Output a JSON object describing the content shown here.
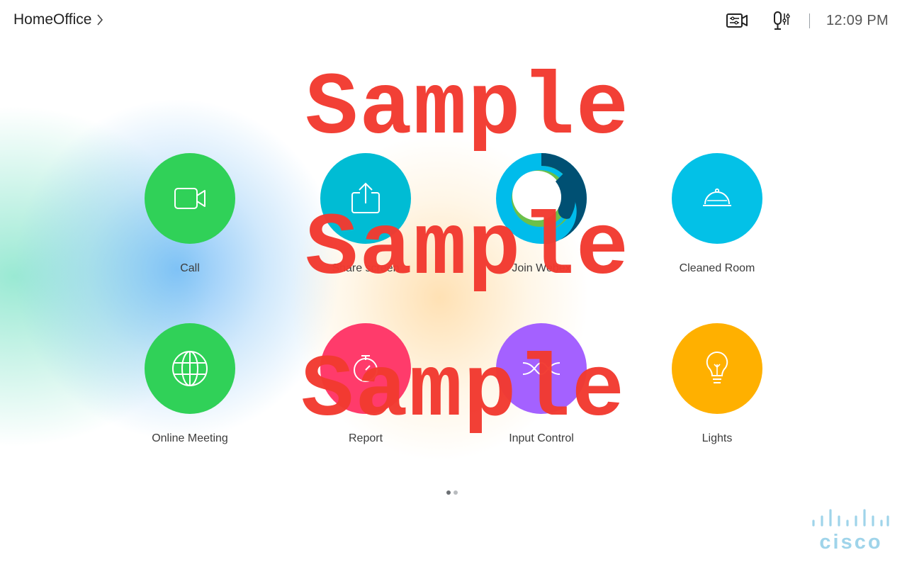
{
  "header": {
    "room_name": "HomeOffice",
    "time": "12:09 PM",
    "camera_icon": "camera-controls-icon",
    "mic_icon": "microphone-controls-icon",
    "chevron_icon": "chevron-right-icon"
  },
  "tiles": [
    {
      "label": "Call",
      "color": "#30d158",
      "icon": "video-camera-icon"
    },
    {
      "label": "Share screen",
      "color": "#00bcd4",
      "icon": "share-upload-icon"
    },
    {
      "label": "Join Webex",
      "color": "#00bceb",
      "icon": "webex-logo-icon"
    },
    {
      "label": "Cleaned Room",
      "color": "#03c1e7",
      "icon": "service-bell-icon"
    },
    {
      "label": "Online Meeting",
      "color": "#30d158",
      "icon": "globe-icon"
    },
    {
      "label": "Report",
      "color": "#ff3b6b",
      "icon": "report-icon"
    },
    {
      "label": "Input Control",
      "color": "#a461ff",
      "icon": "input-control-icon"
    },
    {
      "label": "Lights",
      "color": "#ffb000",
      "icon": "lightbulb-icon"
    }
  ],
  "pagination": {
    "pages": 2,
    "current": 1
  },
  "logo": {
    "text": "cisco",
    "color": "#9fd4ea"
  },
  "watermark": [
    "Sample",
    "Sample",
    "Sample"
  ]
}
